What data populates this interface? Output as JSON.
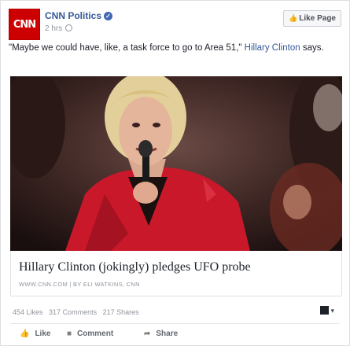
{
  "header": {
    "logo_text": "CNN",
    "page_name": "CNN Politics",
    "verified_icon": "verified-check-icon",
    "timestamp": "2 hrs",
    "like_page_label": "Like Page"
  },
  "post": {
    "quote": "\"Maybe we could have, like, a task force to go to Area 51,\"",
    "mention": "Hillary Clinton",
    "suffix": "says."
  },
  "link_preview": {
    "title": "Hillary Clinton (jokingly) pledges UFO probe",
    "source": "WWW.CNN.COM | BY ELI WATKINS, CNN"
  },
  "stats": {
    "likes": "454 Likes",
    "comments": "317 Comments",
    "shares": "217 Shares"
  },
  "actions": {
    "like": "Like",
    "comment": "Comment",
    "share": "Share"
  },
  "colors": {
    "brand_red": "#cc0000",
    "facebook_link": "#365899",
    "jacket_red": "#c8182a"
  }
}
